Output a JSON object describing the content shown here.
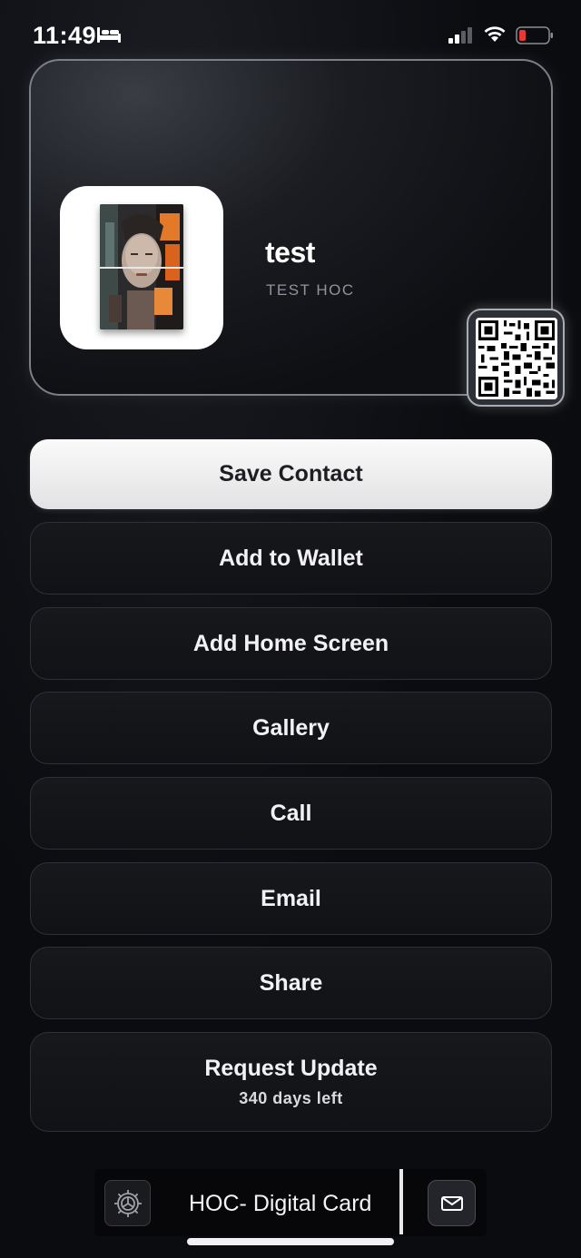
{
  "status_bar": {
    "time": "11:49",
    "battery_color": "#e53935"
  },
  "card": {
    "name": "test",
    "company": "TEST HOC"
  },
  "actions": {
    "save_contact": "Save Contact",
    "add_to_wallet": "Add to Wallet",
    "add_home_screen": "Add Home Screen",
    "gallery": "Gallery",
    "call": "Call",
    "email": "Email",
    "share": "Share",
    "request_update": "Request Update",
    "request_update_sub": "340 days left"
  },
  "bottom_bar": {
    "title": "HOC- Digital Card",
    "left_icon": "settings-gear-icon",
    "right_icon": "mail-icon"
  },
  "colors": {
    "background": "#0b0c10",
    "primary_button": "#f2f2f4",
    "button_dark": "#141519"
  }
}
